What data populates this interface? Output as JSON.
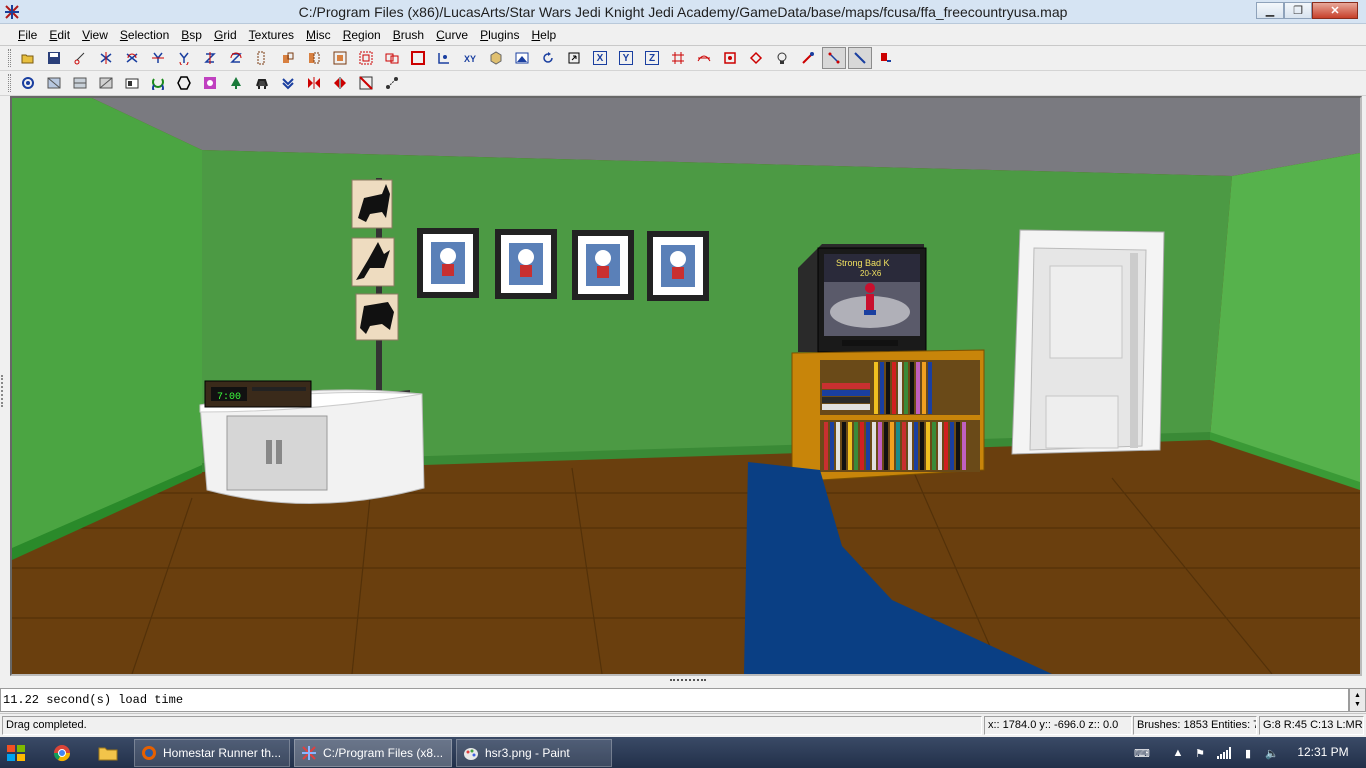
{
  "window": {
    "title": "C:/Program Files (x86)/LucasArts/Star Wars Jedi Knight Jedi Academy/GameData/base/maps/fcusa/ffa_freecountryusa.map",
    "app_icon": "radiant-icon",
    "buttons": {
      "minimize": "minimize-icon",
      "maximize": "restore-icon",
      "close": "close-icon"
    }
  },
  "menu": [
    {
      "key": "F",
      "rest": "ile"
    },
    {
      "key": "E",
      "rest": "dit"
    },
    {
      "key": "V",
      "rest": "iew"
    },
    {
      "key": "S",
      "rest": "election"
    },
    {
      "key": "B",
      "rest": "sp"
    },
    {
      "key": "G",
      "rest": "rid"
    },
    {
      "key": "T",
      "rest": "extures"
    },
    {
      "key": "M",
      "rest": "isc"
    },
    {
      "key": "R",
      "rest": "egion"
    },
    {
      "key": "B",
      "rest": "rush"
    },
    {
      "key": "C",
      "rest": "urve"
    },
    {
      "key": "P",
      "rest": "lugins"
    },
    {
      "key": "H",
      "rest": "elp"
    }
  ],
  "toolbar1": {
    "open_icon": "open-folder-icon",
    "save_icon": "save-disk-icon",
    "x_axis_label": "X",
    "y_axis_label": "Y",
    "z_axis_label": "Z"
  },
  "toolbar2": {
    "count": 15
  },
  "console": {
    "text": "11.22 second(s) load time"
  },
  "statusbar": {
    "message": "Drag completed.",
    "coords": "x:: 1784.0  y:: -696.0  z:: 0.0",
    "counts": "Brushes: 1853 Entities: 7",
    "grid": "G:8 R:45 C:13 L:MR"
  },
  "scene": {
    "clock_readout": "7:00",
    "tv_title_line1": "Strong Bad K",
    "tv_title_line2": "20-X6"
  },
  "taskbar": {
    "tasks": [
      {
        "label": "Homestar Runner th...",
        "icon": "firefox-icon"
      },
      {
        "label": "C:/Program Files (x8...",
        "icon": "radiant-icon"
      },
      {
        "label": "hsr3.png - Paint",
        "icon": "paint-icon"
      }
    ],
    "clock": "12:31 PM"
  },
  "colors": {
    "wall": "#4c9a44",
    "ceiling": "#7a7a80",
    "floor": "#6a3f0e",
    "rug": "#0a3f84"
  }
}
